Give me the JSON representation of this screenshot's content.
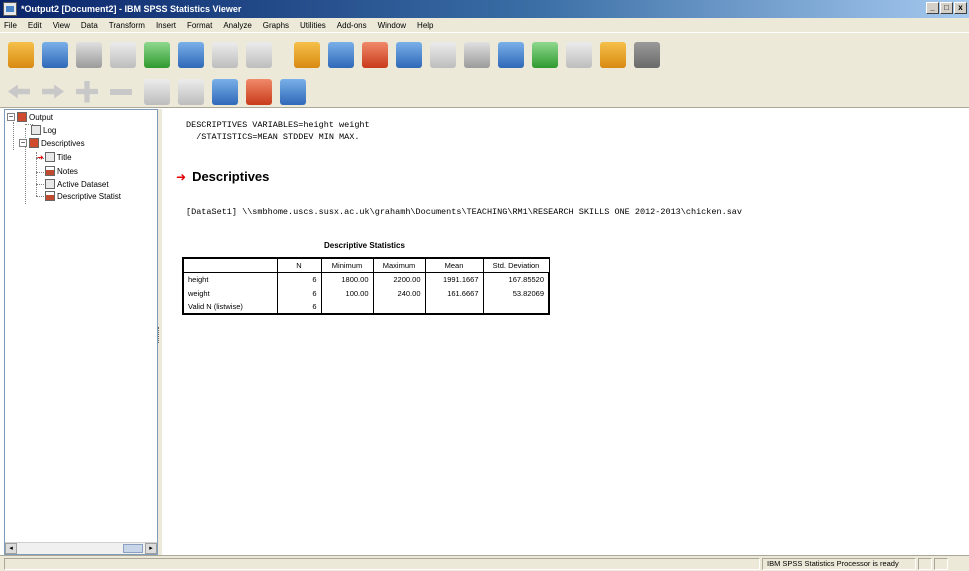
{
  "window": {
    "title": "*Output2 [Document2] - IBM SPSS Statistics Viewer",
    "controls": [
      "_",
      "□",
      "x"
    ]
  },
  "menu": [
    "File",
    "Edit",
    "View",
    "Data",
    "Transform",
    "Insert",
    "Format",
    "Analyze",
    "Graphs",
    "Utilities",
    "Add-ons",
    "Window",
    "Help"
  ],
  "outline": {
    "items": [
      {
        "label": "Output"
      },
      {
        "label": "Log"
      },
      {
        "label": "Descriptives"
      },
      {
        "label": "Title"
      },
      {
        "label": "Notes"
      },
      {
        "label": "Active Dataset"
      },
      {
        "label": "Descriptive Statist"
      }
    ],
    "expander_minus": "−",
    "scroll_left": "◂",
    "scroll_right": "▸"
  },
  "content": {
    "syntax": "DESCRIPTIVES VARIABLES=height weight\n  /STATISTICS=MEAN STDDEV MIN MAX.",
    "heading": "Descriptives",
    "heading_arrow": "➜",
    "dataset_line": "[DataSet1] \\\\smbhome.uscs.susx.ac.uk\\grahamh\\Documents\\TEACHING\\RM1\\RESEARCH SKILLS ONE 2012-2013\\chicken.sav",
    "table": {
      "title": "Descriptive Statistics",
      "headers": [
        "",
        "N",
        "Minimum",
        "Maximum",
        "Mean",
        "Std. Deviation"
      ],
      "rows": [
        [
          "height",
          "6",
          "1800.00",
          "2200.00",
          "1991.1667",
          "167.85520"
        ],
        [
          "weight",
          "6",
          "100.00",
          "240.00",
          "161.6667",
          "53.82069"
        ],
        [
          "Valid N (listwise)",
          "6",
          "",
          "",
          "",
          ""
        ]
      ]
    }
  },
  "status": {
    "text": "IBM SPSS Statistics Processor is ready"
  },
  "colors": {
    "titlebar": "#0a246a",
    "accent_red": "#e00000",
    "chrome": "#ece9d8"
  }
}
